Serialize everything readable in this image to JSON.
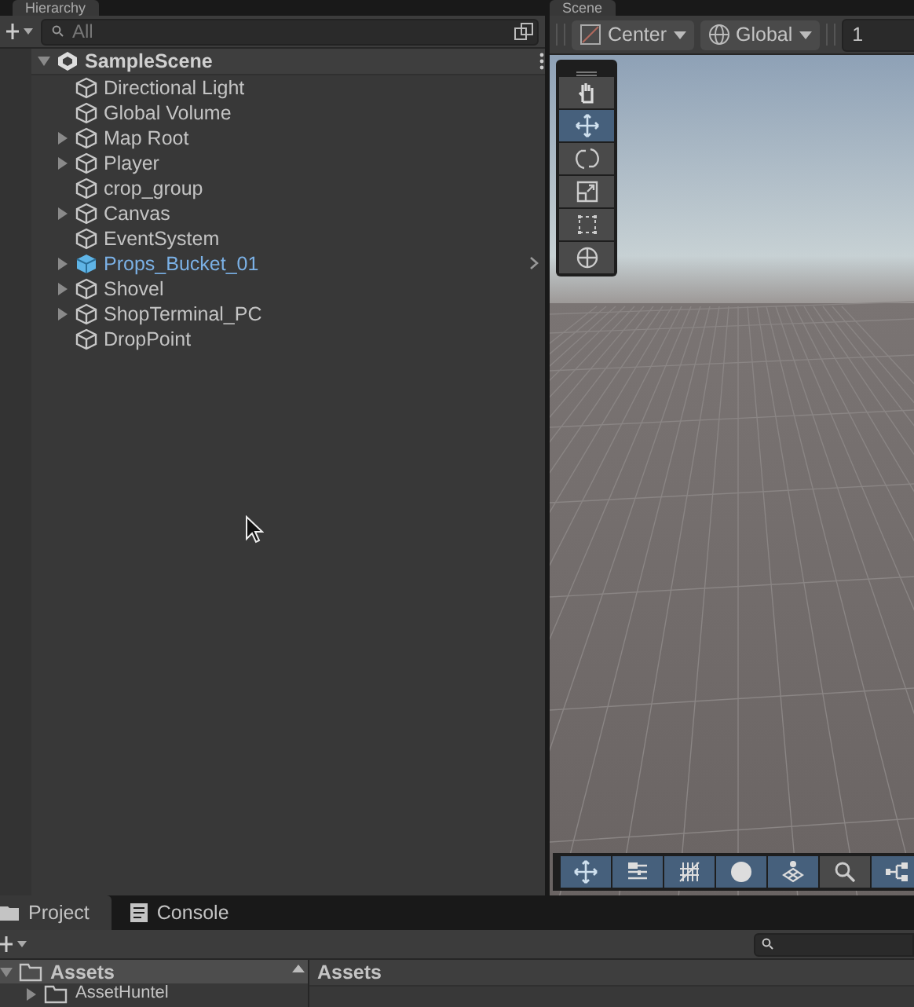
{
  "top_tabs": [
    {
      "label": "Hierarchy",
      "selected": true
    },
    {
      "label": "Scene",
      "selected": true
    }
  ],
  "hierarchy": {
    "search": {
      "placeholder": "All"
    },
    "scene": {
      "name": "SampleScene",
      "expanded": true
    },
    "items": [
      {
        "name": "Directional Light",
        "kind": "object",
        "expandable": false
      },
      {
        "name": "Global Volume",
        "kind": "object",
        "expandable": false
      },
      {
        "name": "Map Root",
        "kind": "object",
        "expandable": true
      },
      {
        "name": "Player",
        "kind": "object",
        "expandable": true
      },
      {
        "name": "crop_group",
        "kind": "object",
        "expandable": false
      },
      {
        "name": "Canvas",
        "kind": "object",
        "expandable": true
      },
      {
        "name": "EventSystem",
        "kind": "object",
        "expandable": false
      },
      {
        "name": "Props_Bucket_01",
        "kind": "prefab",
        "expandable": true
      },
      {
        "name": "Shovel",
        "kind": "object",
        "expandable": true
      },
      {
        "name": "ShopTerminal_PC",
        "kind": "object",
        "expandable": true
      },
      {
        "name": "DropPoint",
        "kind": "object",
        "expandable": false
      }
    ]
  },
  "scene_toolbar": {
    "pivot": "Center",
    "space": "Global",
    "field": "1"
  },
  "tools": [
    {
      "kind": "hand",
      "selected": false
    },
    {
      "kind": "move",
      "selected": true
    },
    {
      "kind": "rotate",
      "selected": false
    },
    {
      "kind": "scale",
      "selected": false
    },
    {
      "kind": "rect",
      "selected": false
    },
    {
      "kind": "transform",
      "selected": false
    }
  ],
  "overlay_buttons": [
    {
      "kind": "move",
      "on": true
    },
    {
      "kind": "sliders",
      "on": true
    },
    {
      "kind": "grid",
      "on": true
    },
    {
      "kind": "sphere",
      "on": true
    },
    {
      "kind": "layers",
      "on": true
    },
    {
      "kind": "search",
      "on": false
    },
    {
      "kind": "nodes",
      "on": true
    }
  ],
  "bottom_tabs": [
    {
      "label": "Project",
      "kind": "folder",
      "selected": true
    },
    {
      "label": "Console",
      "kind": "console",
      "selected": false
    }
  ],
  "project": {
    "tree": [
      {
        "name": "Assets",
        "selected": true,
        "children": [
          {
            "name": "AssetHuntel",
            "selected": false
          }
        ]
      }
    ],
    "breadcrumb": "Assets"
  }
}
